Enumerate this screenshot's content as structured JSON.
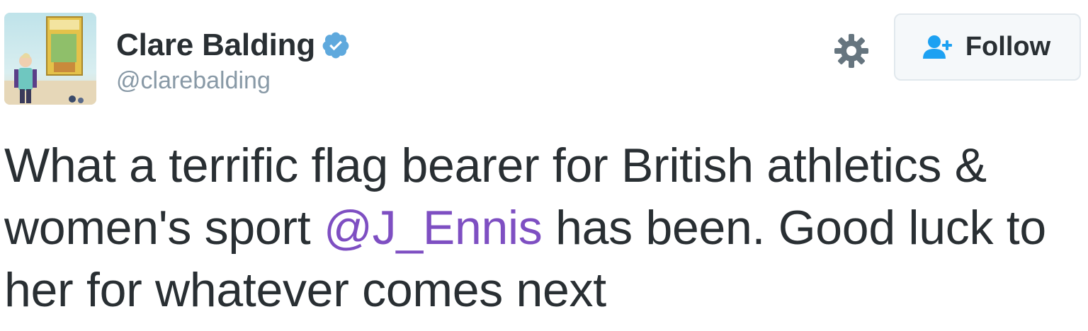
{
  "user": {
    "display_name": "Clare Balding",
    "handle": "@clarebalding",
    "verified": true
  },
  "actions": {
    "follow_label": "Follow",
    "settings_icon": "gear-icon",
    "follow_icon": "add-user-icon"
  },
  "tweet": {
    "text_before_mention": "What a terrific flag bearer for British athletics & women's sport ",
    "mention": "@J_Ennis",
    "text_after_mention": " has been. Good luck to her for whatever comes next"
  },
  "colors": {
    "text": "#292f33",
    "secondary_text": "#8899a6",
    "mention": "#7e4fc2",
    "verified_badge": "#5fa9dd",
    "follow_icon": "#1da1f2",
    "button_bg": "#f5f8fa",
    "button_border": "#e1e8ed"
  }
}
